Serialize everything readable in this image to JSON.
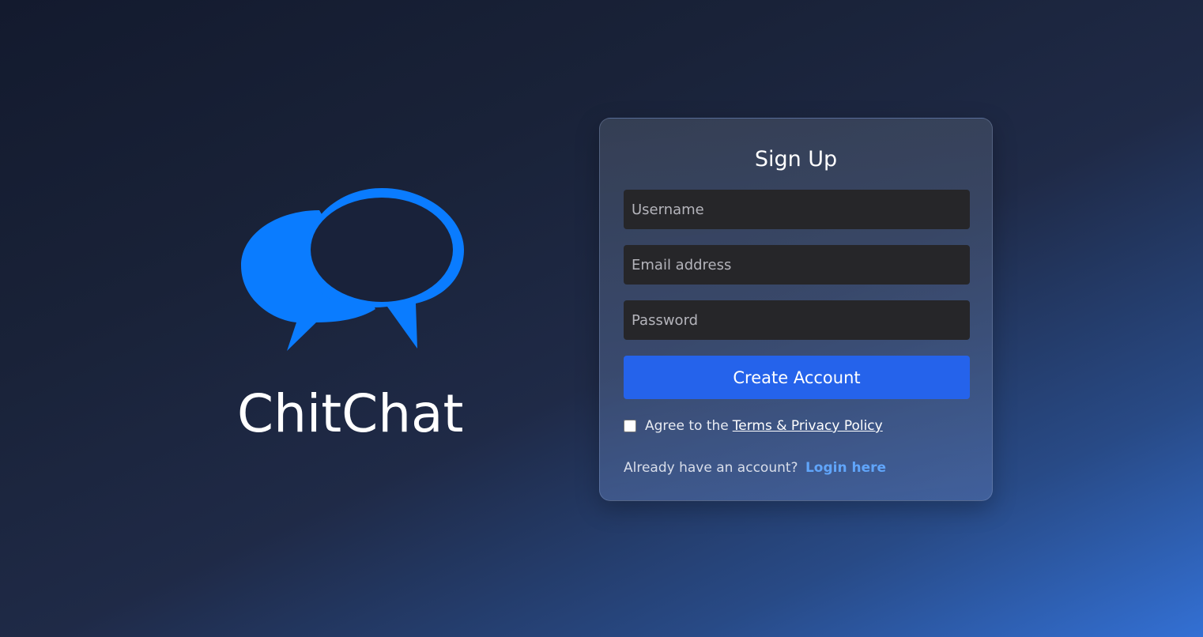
{
  "brand": {
    "app_name": "ChitChat",
    "logo_icon": "chat-bubbles-icon",
    "logo_color": "#0a7cff"
  },
  "signup": {
    "title": "Sign Up",
    "username_placeholder": "Username",
    "email_placeholder": "Email address",
    "password_placeholder": "Password",
    "create_button": "Create Account",
    "agree_prefix": "Agree to the",
    "terms_link": "Terms & Privacy Policy",
    "agree_checked": false,
    "login_prompt": "Already have an account?",
    "login_link": "Login here"
  },
  "colors": {
    "primary_button": "#2563eb",
    "link": "#60a5fa",
    "input_bg": "#262629"
  }
}
